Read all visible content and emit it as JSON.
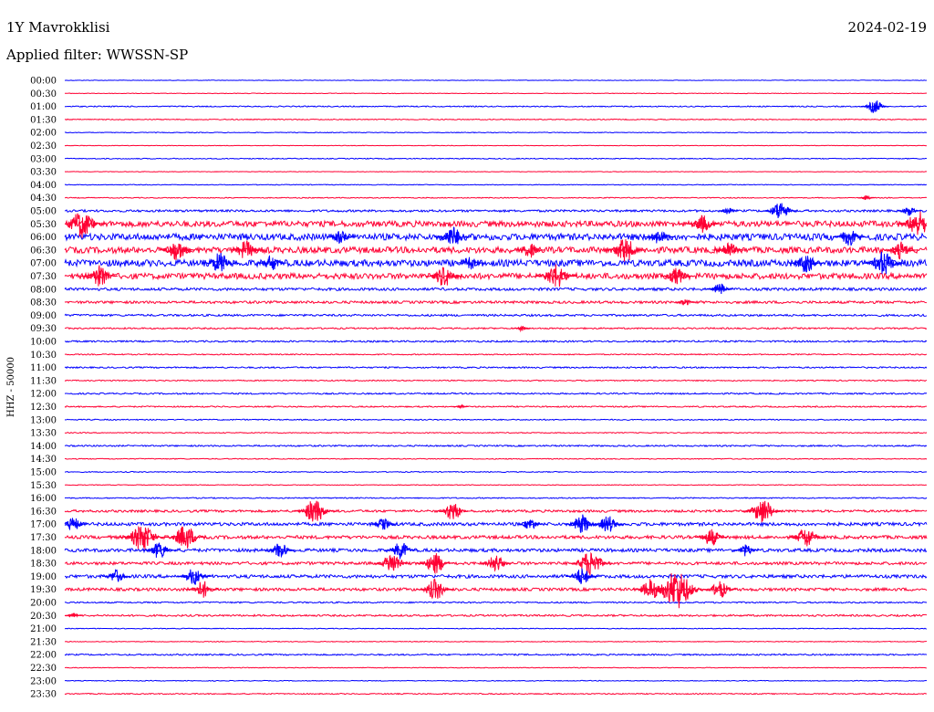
{
  "header": {
    "station": "1Y Mavrokklisi",
    "date": "2024-02-19",
    "filter": "Applied filter: WWSSN-SP"
  },
  "chart_data": {
    "type": "line",
    "title": "1Y Mavrokklisi",
    "subtitle": "Applied filter: WWSSN-SP",
    "ylabel": "HHZ - 50000",
    "xlabel": "",
    "colors": {
      "even": "#0000ff",
      "odd": "#ff0033"
    },
    "grid": false,
    "row_labels": [
      "00:00",
      "00:30",
      "01:00",
      "01:30",
      "02:00",
      "02:30",
      "03:00",
      "03:30",
      "04:00",
      "04:30",
      "05:00",
      "05:30",
      "06:00",
      "06:30",
      "07:00",
      "07:30",
      "08:00",
      "08:30",
      "09:00",
      "09:30",
      "10:00",
      "10:30",
      "11:00",
      "11:30",
      "12:00",
      "12:30",
      "13:00",
      "13:30",
      "14:00",
      "14:30",
      "15:00",
      "15:30",
      "16:00",
      "16:30",
      "17:00",
      "17:30",
      "18:00",
      "18:30",
      "19:00",
      "19:30",
      "20:00",
      "20:30",
      "21:00",
      "21:30",
      "22:00",
      "22:30",
      "23:00",
      "23:30"
    ],
    "noise_level": [
      0.3,
      0.3,
      0.6,
      0.5,
      0.4,
      0.3,
      0.5,
      0.3,
      0.4,
      0.5,
      1.2,
      3.2,
      3.6,
      3.4,
      3.6,
      3.2,
      1.5,
      1.4,
      1.1,
      0.8,
      0.9,
      0.6,
      0.8,
      0.6,
      0.8,
      0.7,
      0.6,
      0.5,
      0.8,
      0.5,
      0.5,
      0.4,
      0.6,
      1.3,
      1.8,
      1.8,
      1.8,
      1.6,
      1.8,
      1.6,
      0.8,
      1.0,
      0.4,
      0.4,
      0.8,
      0.4,
      0.4,
      0.6
    ],
    "events": [
      {
        "row": "01:00",
        "x": 0.94,
        "amplitude": 8
      },
      {
        "row": "04:30",
        "x": 0.93,
        "amplitude": 3
      },
      {
        "row": "05:00",
        "x": 0.83,
        "amplitude": 11
      },
      {
        "row": "05:00",
        "x": 0.77,
        "amplitude": 4
      },
      {
        "row": "05:00",
        "x": 0.98,
        "amplitude": 6
      },
      {
        "row": "05:30",
        "x": 0.02,
        "amplitude": 16
      },
      {
        "row": "05:30",
        "x": 0.74,
        "amplitude": 10
      },
      {
        "row": "05:30",
        "x": 0.99,
        "amplitude": 15
      },
      {
        "row": "06:00",
        "x": 0.32,
        "amplitude": 8
      },
      {
        "row": "06:00",
        "x": 0.45,
        "amplitude": 12
      },
      {
        "row": "06:00",
        "x": 0.69,
        "amplitude": 9
      },
      {
        "row": "06:00",
        "x": 0.91,
        "amplitude": 10
      },
      {
        "row": "06:30",
        "x": 0.13,
        "amplitude": 12
      },
      {
        "row": "06:30",
        "x": 0.21,
        "amplitude": 11
      },
      {
        "row": "06:30",
        "x": 0.54,
        "amplitude": 9
      },
      {
        "row": "06:30",
        "x": 0.65,
        "amplitude": 14
      },
      {
        "row": "06:30",
        "x": 0.77,
        "amplitude": 10
      },
      {
        "row": "06:30",
        "x": 0.97,
        "amplitude": 10
      },
      {
        "row": "07:00",
        "x": 0.18,
        "amplitude": 12
      },
      {
        "row": "07:00",
        "x": 0.24,
        "amplitude": 9
      },
      {
        "row": "07:00",
        "x": 0.47,
        "amplitude": 8
      },
      {
        "row": "07:00",
        "x": 0.86,
        "amplitude": 11
      },
      {
        "row": "07:00",
        "x": 0.95,
        "amplitude": 14
      },
      {
        "row": "07:30",
        "x": 0.04,
        "amplitude": 12
      },
      {
        "row": "07:30",
        "x": 0.44,
        "amplitude": 12
      },
      {
        "row": "07:30",
        "x": 0.57,
        "amplitude": 14
      },
      {
        "row": "07:30",
        "x": 0.71,
        "amplitude": 10
      },
      {
        "row": "08:00",
        "x": 0.76,
        "amplitude": 7
      },
      {
        "row": "08:30",
        "x": 0.72,
        "amplitude": 4
      },
      {
        "row": "09:30",
        "x": 0.53,
        "amplitude": 3
      },
      {
        "row": "12:30",
        "x": 0.46,
        "amplitude": 2
      },
      {
        "row": "16:30",
        "x": 0.29,
        "amplitude": 14
      },
      {
        "row": "16:30",
        "x": 0.45,
        "amplitude": 11
      },
      {
        "row": "16:30",
        "x": 0.81,
        "amplitude": 14
      },
      {
        "row": "17:00",
        "x": 0.01,
        "amplitude": 8
      },
      {
        "row": "17:00",
        "x": 0.37,
        "amplitude": 7
      },
      {
        "row": "17:00",
        "x": 0.54,
        "amplitude": 7
      },
      {
        "row": "17:00",
        "x": 0.6,
        "amplitude": 11
      },
      {
        "row": "17:00",
        "x": 0.63,
        "amplitude": 10
      },
      {
        "row": "17:30",
        "x": 0.09,
        "amplitude": 16
      },
      {
        "row": "17:30",
        "x": 0.14,
        "amplitude": 14
      },
      {
        "row": "17:30",
        "x": 0.75,
        "amplitude": 10
      },
      {
        "row": "17:30",
        "x": 0.86,
        "amplitude": 12
      },
      {
        "row": "18:00",
        "x": 0.11,
        "amplitude": 10
      },
      {
        "row": "18:00",
        "x": 0.25,
        "amplitude": 9
      },
      {
        "row": "18:00",
        "x": 0.39,
        "amplitude": 10
      },
      {
        "row": "18:00",
        "x": 0.79,
        "amplitude": 7
      },
      {
        "row": "18:30",
        "x": 0.38,
        "amplitude": 12
      },
      {
        "row": "18:30",
        "x": 0.43,
        "amplitude": 12
      },
      {
        "row": "18:30",
        "x": 0.5,
        "amplitude": 10
      },
      {
        "row": "18:30",
        "x": 0.61,
        "amplitude": 15
      },
      {
        "row": "19:00",
        "x": 0.06,
        "amplitude": 8
      },
      {
        "row": "19:00",
        "x": 0.15,
        "amplitude": 10
      },
      {
        "row": "19:00",
        "x": 0.6,
        "amplitude": 10
      },
      {
        "row": "19:30",
        "x": 0.16,
        "amplitude": 10
      },
      {
        "row": "19:30",
        "x": 0.43,
        "amplitude": 12
      },
      {
        "row": "19:30",
        "x": 0.68,
        "amplitude": 12
      },
      {
        "row": "19:30",
        "x": 0.71,
        "amplitude": 22
      },
      {
        "row": "19:30",
        "x": 0.76,
        "amplitude": 10
      },
      {
        "row": "20:30",
        "x": 0.01,
        "amplitude": 3
      }
    ]
  }
}
